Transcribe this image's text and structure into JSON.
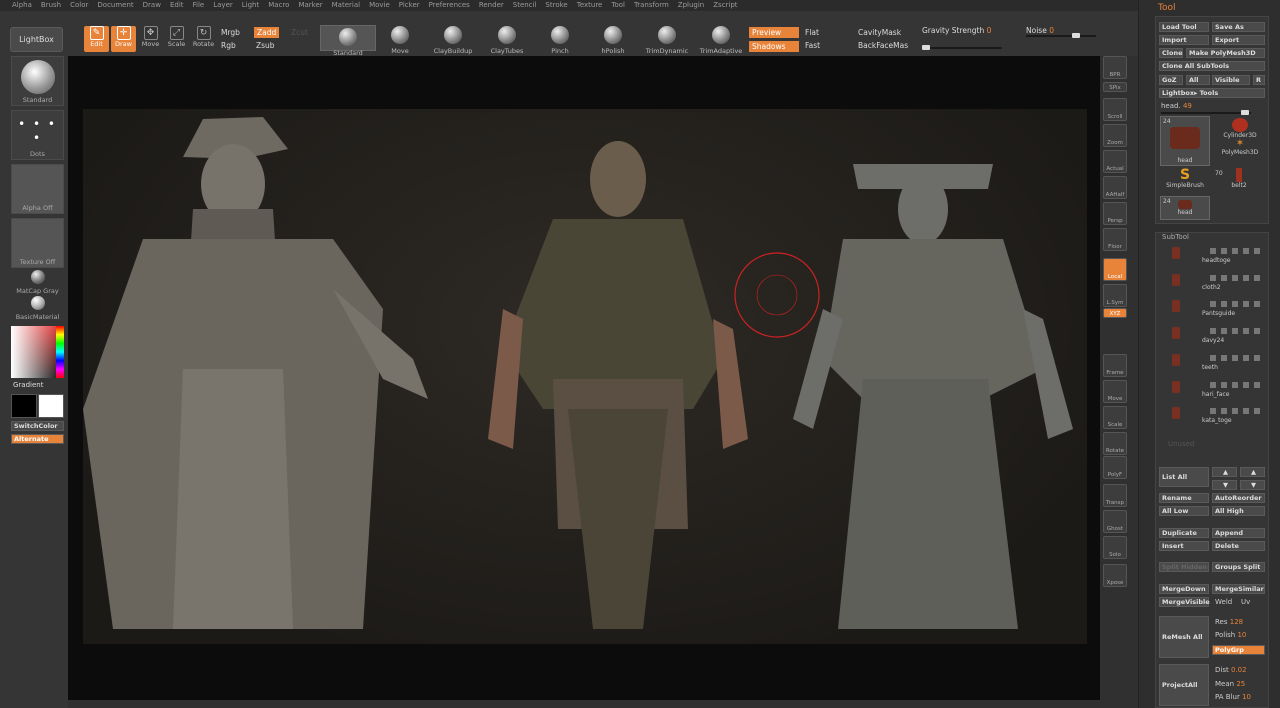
{
  "menu": [
    "Alpha",
    "Brush",
    "Color",
    "Document",
    "Draw",
    "Edit",
    "File",
    "Layer",
    "Light",
    "Macro",
    "Marker",
    "Material",
    "Movie",
    "Picker",
    "Preferences",
    "Render",
    "Stencil",
    "Stroke",
    "Texture",
    "Tool",
    "Transform",
    "Zplugin",
    "Zscript"
  ],
  "toolbar": {
    "lightbox": "LightBox",
    "edit": "Edit",
    "draw": "Draw",
    "move": "Move",
    "scale": "Scale",
    "rotate": "Rotate",
    "mrgb": "Mrgb",
    "rgb": "Rgb",
    "m": "M",
    "zadd": "Zadd",
    "zsub": "Zsub",
    "zcut": "Zcut",
    "brushes": [
      "Standard",
      "Move",
      "ClayBuildup",
      "ClayTubes",
      "Pinch",
      "hPolish",
      "TrimDynamic",
      "TrimAdaptive"
    ],
    "preview": "Preview",
    "shadows": "Shadows",
    "flat": "Flat",
    "fast": "Fast",
    "cavitymask": "CavityMask",
    "backfacemask": "BackFaceMas",
    "gravity_label": "Gravity Strength",
    "gravity_value": "0",
    "noise_label": "Noise",
    "noise_value": "0"
  },
  "left_shelf": {
    "brush": "Standard",
    "stroke": "Dots",
    "alpha": "Alpha  Off",
    "texture": "Texture  Off",
    "matcap": "MatCap  Gray",
    "basic": "BasicMaterial",
    "gradient": "Gradient",
    "switchcolor": "SwitchColor",
    "alternate": "Alternate"
  },
  "right_shelf": [
    "BPR",
    "SPix",
    "Scroll",
    "Zoom",
    "Actual",
    "AAHalf",
    "Persp",
    "Floor",
    "Local",
    "L.Sym",
    "XYZ",
    "Frame",
    "Move",
    "Scale",
    "Rotate",
    "PolyF",
    "Transp",
    "Ghost",
    "Solo",
    "Xpose"
  ],
  "tool_panel": {
    "title": "Tool",
    "load": "Load Tool",
    "save": "Save As",
    "import": "Import",
    "export": "Export",
    "clone": "Clone",
    "make": "Make PolyMesh3D",
    "cloneall": "Clone  All SubTools",
    "goz": "GoZ",
    "all": "All",
    "visible": "Visible",
    "r": "R",
    "lightboxtools": "Lightbox▸ Tools",
    "current_label": "head.",
    "current_value": "49",
    "tools": [
      "head",
      "Cylinder3D",
      "PolyMesh3D",
      "SimpleBrush",
      "belt2",
      "head"
    ],
    "counts": [
      "24",
      "70",
      "24"
    ]
  },
  "subtool": {
    "title": "SubTool",
    "items": [
      "headtoge",
      "cloth2",
      "Pantsguide",
      "davy24",
      "teeth",
      "hari_face",
      "kata_toge"
    ],
    "listall": "List  All",
    "rename": "Rename",
    "autoreorder": "AutoReorder",
    "alllow": "All  Low",
    "allhigh": "All  High",
    "duplicate": "Duplicate",
    "append": "Append",
    "insert": "Insert",
    "delete": "Delete",
    "groupssplit": "Groups  Split",
    "split_hidden": "Split Hidden",
    "mergedown": "MergeDown",
    "mergesimilar": "MergeSimilar",
    "mergevisible": "MergeVisible",
    "weld": "Weld",
    "uv": "Uv",
    "remeshall": "ReMesh  All",
    "res_label": "Res",
    "res_value": "128",
    "polish_label": "Polish",
    "polish_value": "10",
    "polygrp": "PolyGrp",
    "projectall": "ProjectAll",
    "dist_label": "Dist",
    "dist_value": "0.02",
    "mean_label": "Mean",
    "mean_value": "25",
    "pablur_label": "PA  Blur",
    "pablur_value": "10"
  },
  "colors": {
    "accent": "#e8833a",
    "bg": "#303030"
  }
}
